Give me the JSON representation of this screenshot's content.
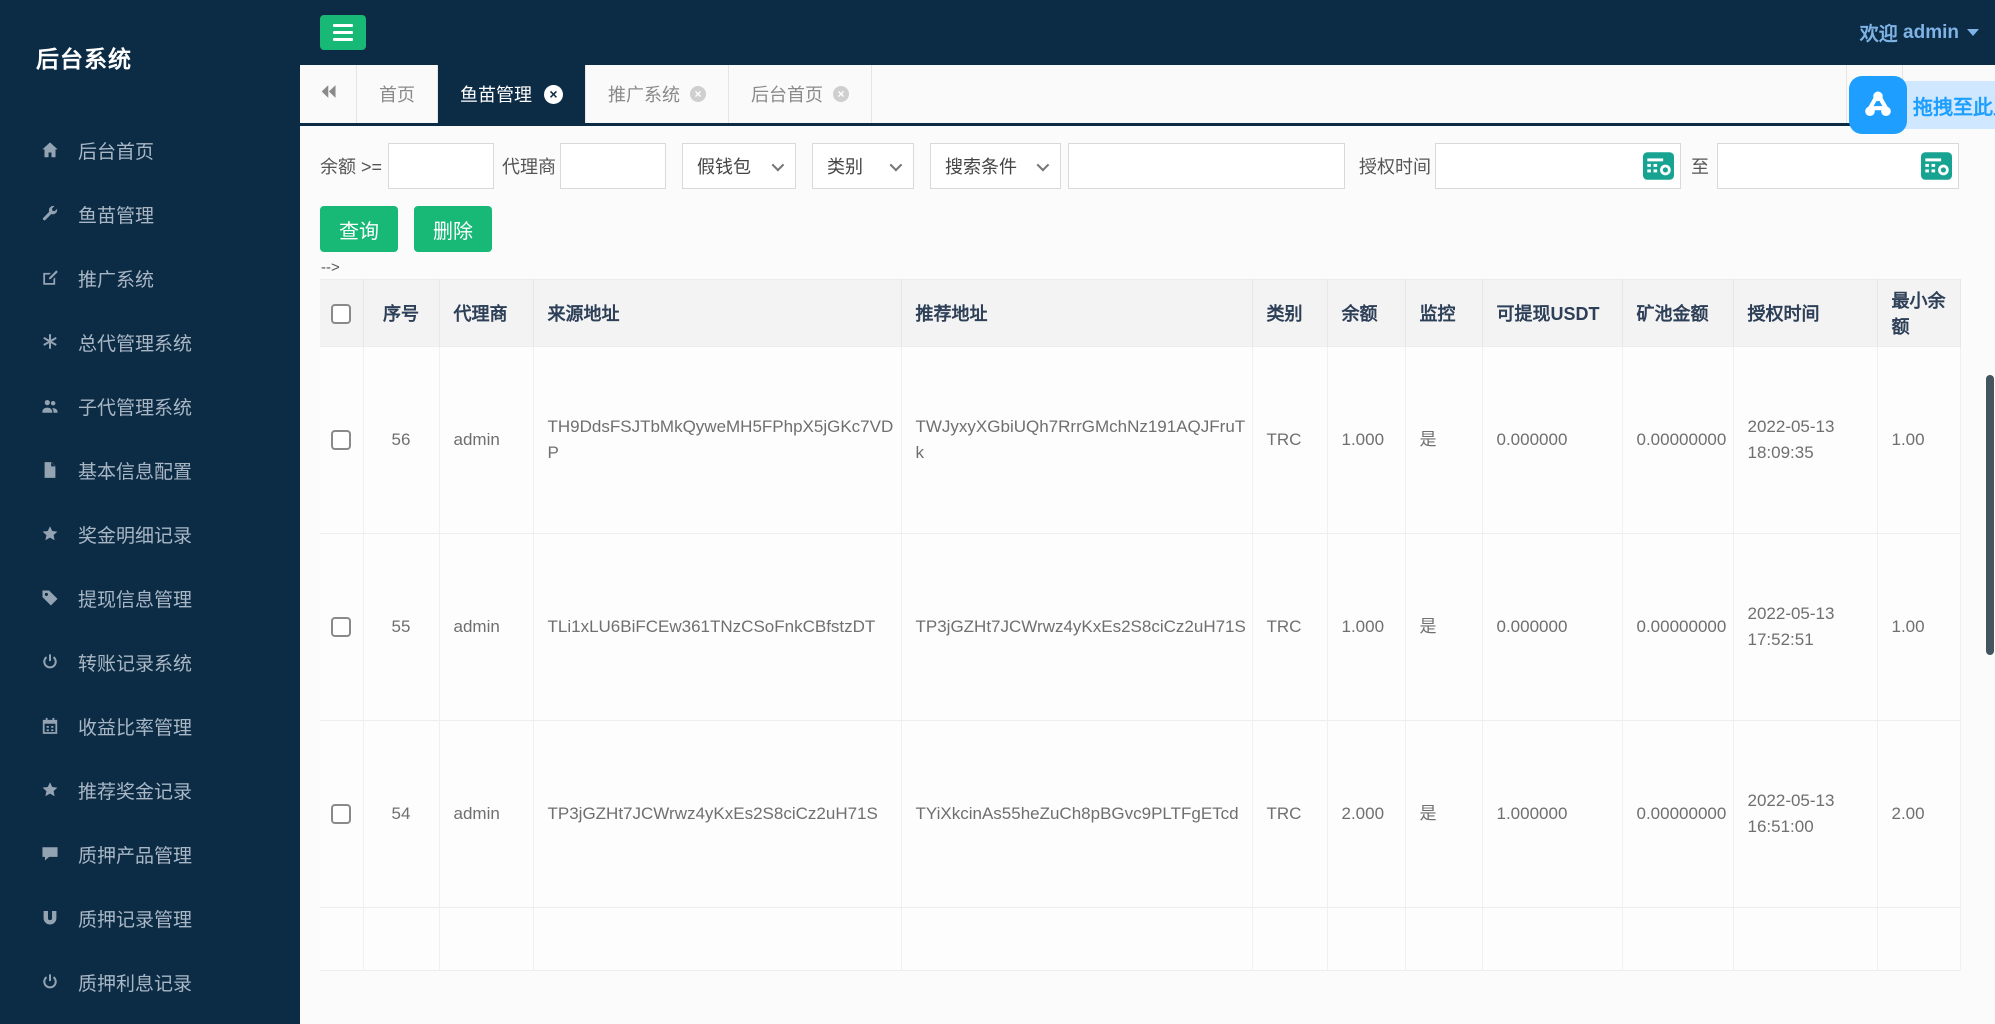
{
  "app": {
    "welcome_label": "欢迎",
    "username": "admin"
  },
  "sidebar": {
    "title": "后台系统",
    "items": [
      {
        "label": "后台首页",
        "icon": "home-icon"
      },
      {
        "label": "鱼苗管理",
        "icon": "wrench-icon"
      },
      {
        "label": "推广系统",
        "icon": "edit-icon"
      },
      {
        "label": "总代管理系统",
        "icon": "asterisk-icon"
      },
      {
        "label": "子代管理系统",
        "icon": "users-icon"
      },
      {
        "label": "基本信息配置",
        "icon": "file-icon"
      },
      {
        "label": "奖金明细记录",
        "icon": "star-icon"
      },
      {
        "label": "提现信息管理",
        "icon": "tag-icon"
      },
      {
        "label": "转账记录系统",
        "icon": "power-icon"
      },
      {
        "label": "收益比率管理",
        "icon": "calendar-icon"
      },
      {
        "label": "推荐奖金记录",
        "icon": "star-icon"
      },
      {
        "label": "质押产品管理",
        "icon": "comment-icon"
      },
      {
        "label": "质押记录管理",
        "icon": "magnet-icon"
      },
      {
        "label": "质押利息记录",
        "icon": "power-icon"
      }
    ]
  },
  "tabs": {
    "items": [
      {
        "label": "首页",
        "active": false,
        "closable": false
      },
      {
        "label": "鱼苗管理",
        "active": true,
        "closable": true
      },
      {
        "label": "推广系统",
        "active": false,
        "closable": true
      },
      {
        "label": "后台首页",
        "active": false,
        "closable": true
      }
    ],
    "close_label": "关闭"
  },
  "upload_widget": {
    "text": "拖拽至此上传"
  },
  "filters": {
    "balance_label": "余额 >=",
    "agent_label": "代理商",
    "selects": [
      {
        "label": "假钱包"
      },
      {
        "label": "类别"
      },
      {
        "label": "搜索条件"
      }
    ],
    "auth_time_label": "授权时间",
    "to_label": "至",
    "query_button": "查询",
    "delete_button": "删除",
    "comment_text": "-->"
  },
  "table": {
    "columns": [
      "序号",
      "代理商",
      "来源地址",
      "推荐地址",
      "类别",
      "余额",
      "监控",
      "可提现USDT",
      "矿池金额",
      "授权时间",
      "最小余额"
    ],
    "rows": [
      {
        "seq": "56",
        "agent": "admin",
        "source": "TH9DdsFSJTbMkQyweMH5FPhpX5jGKc7VDP",
        "referral": "TWJyxyXGbiUQh7RrrGMchNz191AQJFruTk",
        "category": "TRC",
        "balance": "1.000",
        "monitor": "是",
        "withdrawable_usdt": "0.000000",
        "pool_amount": "0.00000000",
        "auth_time": "2022-05-13 18:09:35",
        "min_balance": "1.00"
      },
      {
        "seq": "55",
        "agent": "admin",
        "source": "TLi1xLU6BiFCEw361TNzCSoFnkCBfstzDT",
        "referral": "TP3jGZHt7JCWrwz4yKxEs2S8ciCz2uH71S",
        "category": "TRC",
        "balance": "1.000",
        "monitor": "是",
        "withdrawable_usdt": "0.000000",
        "pool_amount": "0.00000000",
        "auth_time": "2022-05-13 17:52:51",
        "min_balance": "1.00"
      },
      {
        "seq": "54",
        "agent": "admin",
        "source": "TP3jGZHt7JCWrwz4yKxEs2S8ciCz2uH71S",
        "referral": "TYiXkcinAs55heZuCh8pBGvc9PLTFgETcd",
        "category": "TRC",
        "balance": "2.000",
        "monitor": "是",
        "withdrawable_usdt": "1.000000",
        "pool_amount": "0.00000000",
        "auth_time": "2022-05-13 16:51:00",
        "min_balance": "2.00"
      }
    ]
  },
  "colors": {
    "navy": "#0c2b45",
    "green": "#18b877",
    "teal_icon": "#17a392",
    "blue_widget": "#1e9fff",
    "welcome_blue": "#7fb2e5"
  }
}
